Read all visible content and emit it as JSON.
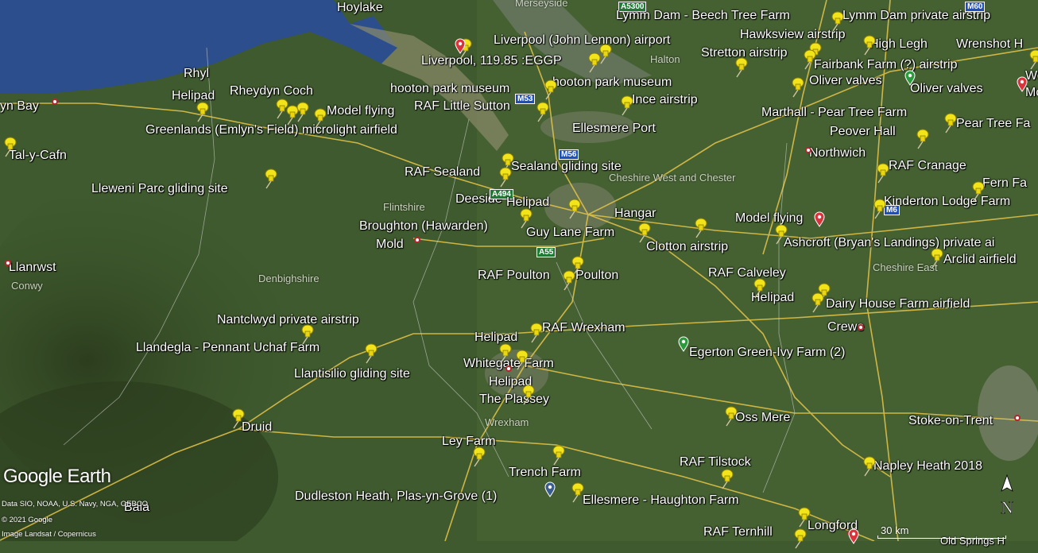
{
  "colors": {
    "sea": "#2d4e8c",
    "land": "#3f5a2e",
    "road": "#e7c54a",
    "pin": "#f2e41a"
  },
  "labels": {
    "hoylake": "Hoylake",
    "merseyside": "Merseyside",
    "a5300": "A5300",
    "lymm_beech": "Lymm Dam - Beech Tree Farm",
    "lymm_private": "Lymm Dam private airstrip",
    "hawksview": "Hawksview airstrip",
    "liverpool_airport": "Liverpool (John Lennon) airport",
    "high_legh": "High Legh",
    "wrenshot": "Wrenshot H",
    "liverpool_freq": "Liverpool, 119.85 :EGGP",
    "halton": "Halton",
    "stretton": "Stretton airstrip",
    "fairbank": "Fairbank Farm (?) airstrip",
    "rhyl": "Rhyl",
    "oliver_valves_1": "Oliver valves",
    "oliver_valves_2": "Oliver valves",
    "wood": "Wood",
    "mo": "Mo",
    "rhyl_helipad": "Helipad",
    "rhyedyn": "Rheydyn Coch",
    "hooton_1": "hooton park museum",
    "hooton_2": "hooton park museum",
    "ince": "Ince airstrip",
    "colwyn_bay": "yn Bay",
    "rhyl_model_flying": "Model flying",
    "raf_little_sutton": "RAF Little Sutton",
    "marthall": "Marthall - Pear Tree Farm",
    "pear_tree": "Pear Tree Fa",
    "greenlands": "Greenlands (Emlyn's Field) microlight airfield",
    "ellesmere_port": "Ellesmere Port",
    "peover": "Peover Hall",
    "tal_y_cafn": "Tal-y-Cafn",
    "northwich": "Northwich",
    "raf_sealand": "RAF Sealand",
    "sealand_gliding": "Sealand gliding site",
    "raf_cranage": "RAF Cranage",
    "cheshire_wc": "Cheshire West and Chester",
    "lleweni": "Lleweni Parc gliding site",
    "deeside": "Deeside",
    "flintshire": "Flintshire",
    "deeside_helipad": "Helipad",
    "fern": "Fern Fa",
    "kinderton": "Kinderton Lodge Farm",
    "hangar": "Hangar",
    "model_flying_2": "Model flying",
    "broughton": "Broughton (Hawarden)",
    "guy_lane": "Guy Lane Farm",
    "ashcroft": "Ashcroft (Bryan's Landings) private ai",
    "mold": "Mold",
    "clotton": "Clotton airstrip",
    "arclid": "Arclid airfield",
    "llanrwst": "Llanrwst",
    "cheshire_east": "Cheshire East",
    "conwy": "Conwy",
    "raf_poulton": "RAF Poulton",
    "poulton": "Poulton",
    "raf_calveley": "RAF Calveley",
    "denbighshire": "Denbighshire",
    "calveley_helipad": "Helipad",
    "dairy_house": "Dairy House Farm airfield",
    "crewe": "Crewe",
    "nantclwyd": "Nantclwyd private airstrip",
    "raf_wrexham": "RAF Wrexham",
    "wrexham_helipad": "Helipad",
    "llandegla": "Llandegla - Pennant Uchaf Farm",
    "egerton": "Egerton Green-Ivy Farm (2)",
    "whitegate": "Whitegate Farm",
    "llantisilio": "Llantisilio gliding site",
    "whitegate_helipad": "Helipad",
    "plassey": "The Plassey",
    "oss_mere": "Oss Mere",
    "wrexham": "Wrexham",
    "stoke": "Stoke-on-Trent",
    "druid": "Druid",
    "ley_farm": "Ley Farm",
    "raf_tilstock": "RAF Tilstock",
    "napley": "Napley Heath 2018",
    "trench": "Trench Farm",
    "dudleston": "Dudleston Heath, Plas-yn-Grove (1)",
    "ellesmere_haughton": "Ellesmere - Haughton Farm",
    "bala": "Bala",
    "raf_ternhill": "RAF Ternhill",
    "longford": "Longford",
    "old_springs": "Old Springs H"
  },
  "roads": {
    "m53": "M53",
    "m56": "M56",
    "a494": "A494",
    "a55": "A55",
    "m6": "M6",
    "m60": "M60"
  },
  "logo": "Google Earth",
  "credits": {
    "data": "Data SIO, NOAA, U.S. Navy, NGA, GEBCO",
    "copyright": "© 2021 Google",
    "image": "Image Landsat / Copernicus"
  },
  "scale": "30 km",
  "compass": "N",
  "icons": {
    "pin": "yellow-pushpin-icon",
    "heli": "helipad-marker-icon",
    "north": "north-arrow-icon"
  }
}
